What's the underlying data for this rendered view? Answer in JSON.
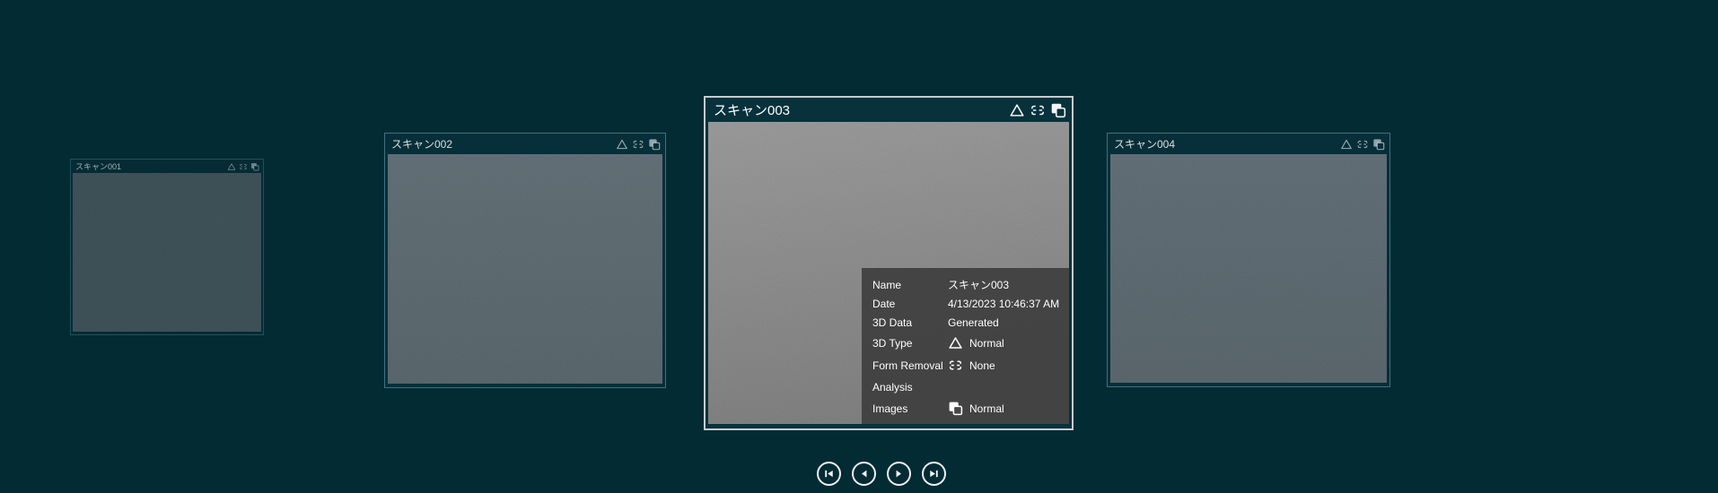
{
  "app": {
    "background_color": "#032b34",
    "selected_card_index": 2
  },
  "carousel": {
    "cards": [
      {
        "title": "スキャン001",
        "selected": false,
        "status_icons": [
          "3d-type-triangle-icon",
          "form-removal-icon",
          "images-icon"
        ]
      },
      {
        "title": "スキャン002",
        "selected": false,
        "status_icons": [
          "3d-type-triangle-icon",
          "form-removal-icon",
          "images-icon"
        ]
      },
      {
        "title": "スキャン003",
        "selected": true,
        "status_icons": [
          "3d-type-triangle-icon",
          "form-removal-icon",
          "images-icon"
        ]
      },
      {
        "title": "スキャン004",
        "selected": false,
        "status_icons": [
          "3d-type-triangle-icon",
          "form-removal-icon",
          "images-icon"
        ]
      }
    ]
  },
  "info_panel": {
    "rows": [
      {
        "label": "Name",
        "value": "スキャン003",
        "icon": ""
      },
      {
        "label": "Date",
        "value": "4/13/2023 10:46:37 AM",
        "icon": ""
      },
      {
        "label": "3D Data",
        "value": "Generated",
        "icon": ""
      },
      {
        "label": "3D Type",
        "value": "Normal",
        "icon": "triangle-icon"
      },
      {
        "label": "Form Removal",
        "value": "None",
        "icon": "form-removal-icon"
      },
      {
        "label": "Analysis",
        "value": "",
        "icon": ""
      },
      {
        "label": "Images",
        "value": "Normal",
        "icon": "images-icon"
      }
    ]
  },
  "navigation": {
    "buttons": [
      {
        "name": "first",
        "icon": "skip-to-first-icon"
      },
      {
        "name": "previous",
        "icon": "previous-icon"
      },
      {
        "name": "next",
        "icon": "next-icon"
      },
      {
        "name": "last",
        "icon": "skip-to-last-icon"
      }
    ]
  },
  "colors": {
    "background": "#032b34",
    "selected_card_border": "#c2ced0",
    "card_border": "#41707f",
    "panel_background": "rgba(56,56,56,0.85)",
    "text": "#ffffff"
  }
}
